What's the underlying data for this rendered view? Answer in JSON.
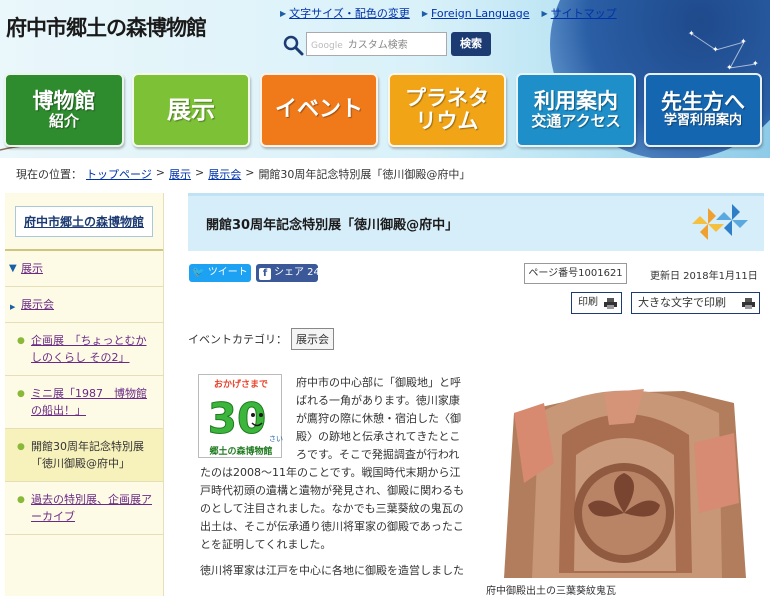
{
  "header": {
    "logo": "府中市郷土の森博物館",
    "links": [
      {
        "label": "文字サイズ・配色の変更"
      },
      {
        "label": "Foreign Language"
      },
      {
        "label": "サイトマップ"
      }
    ],
    "search": {
      "google_label": "Google",
      "placeholder": "カスタム検索",
      "button": "検索"
    }
  },
  "gnav": [
    {
      "l1": "博物館",
      "l2": "紹介",
      "color": "#2e8b2e"
    },
    {
      "l1": "展示",
      "l2": "",
      "color": "#7cc136"
    },
    {
      "l1": "イベント",
      "l2": "",
      "color": "#f07a1a"
    },
    {
      "l1": "プラネタ",
      "l2": "リウム",
      "color": "#f0a416"
    },
    {
      "l1": "利用案内",
      "l2": "交通アクセス",
      "color": "#1e8fc8"
    },
    {
      "l1": "先生方へ",
      "l2": "学習利用案内",
      "color": "#1566b0"
    }
  ],
  "breadcrumb": {
    "prefix": "現在の位置：",
    "items": [
      "トップページ",
      "展示",
      "展示会"
    ],
    "current": "開館30周年記念特別展「徳川御殿@府中」"
  },
  "sidebar": {
    "title": "府中市郷土の森博物館",
    "items": [
      {
        "label": "展示"
      },
      {
        "label": "展示会"
      },
      {
        "label": "企画展　「ちょっとむかしのくらし その2」"
      },
      {
        "label": "ミニ展「1987　博物館の船出！」"
      },
      {
        "label": "開館30周年記念特別展「徳川御殿@府中」"
      },
      {
        "label": "過去の特別展、企画展アーカイブ"
      }
    ]
  },
  "page": {
    "title": "開館30周年記念特別展「徳川御殿@府中」",
    "tweet": "ツイート",
    "share": "シェア 24",
    "page_no": "ページ番号1001621",
    "updated": "更新日 2018年1月11日",
    "print": "印刷",
    "print_large": "大きな文字で印刷",
    "category_label": "イベントカテゴリ：",
    "category": "展示会"
  },
  "badge": {
    "top": "おかげさまで",
    "number": "30",
    "unit": "さい",
    "bottom": "郷土の森博物館"
  },
  "article": {
    "p1": "府中市の中心部に「御殿地」と呼ばれる一角があります。徳川家康が鷹狩の際に休憩・宿泊した〈御殿〉の跡地と伝承されてきたところです。そこで発掘調査が行われたのは2008～11年のことです。戦国時代末期から江戸時代初頭の遺構と遺物が発見され、御殿に関わるものとして注目されました。なかでも三葉葵紋の鬼瓦の出土は、そこが伝承通り徳川将軍家の御殿であったことを証明してくれました。",
    "p2": "徳川将軍家は江戸を中心に各地に御殿を造営しました"
  },
  "photo_caption": "府中御殿出土の三葉葵紋鬼瓦"
}
